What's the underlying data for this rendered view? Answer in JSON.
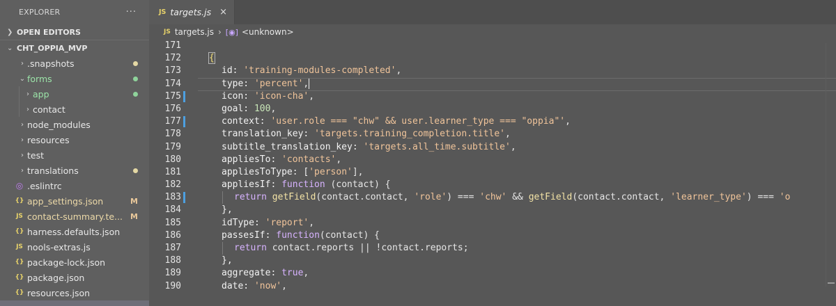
{
  "sidebar": {
    "title": "EXPLORER",
    "more": "···",
    "open_editors": "OPEN EDITORS",
    "project": "CHT_OPPIA_MVP",
    "items": [
      {
        "label": ".snapshots",
        "icon": "folder",
        "status": "dot"
      },
      {
        "label": "forms",
        "icon": "folder-open",
        "status": "dot-green"
      },
      {
        "label": "app",
        "icon": "folder",
        "status": "dot-green"
      },
      {
        "label": "contact",
        "icon": "folder",
        "status": ""
      },
      {
        "label": "node_modules",
        "icon": "folder",
        "status": ""
      },
      {
        "label": "resources",
        "icon": "folder",
        "status": ""
      },
      {
        "label": "test",
        "icon": "folder",
        "status": ""
      },
      {
        "label": "translations",
        "icon": "folder",
        "status": "dot"
      },
      {
        "label": ".eslintrc",
        "icon": "eslint-icon",
        "status": ""
      },
      {
        "label": "app_settings.json",
        "icon": "json-icon",
        "status": "M"
      },
      {
        "label": "contact-summary.te...",
        "icon": "js-icon",
        "status": "M"
      },
      {
        "label": "harness.defaults.json",
        "icon": "json-icon",
        "status": ""
      },
      {
        "label": "nools-extras.js",
        "icon": "js-icon",
        "status": ""
      },
      {
        "label": "package-lock.json",
        "icon": "json-icon",
        "status": ""
      },
      {
        "label": "package.json",
        "icon": "json-icon",
        "status": ""
      },
      {
        "label": "resources.json",
        "icon": "json-icon",
        "status": ""
      }
    ]
  },
  "tab": {
    "label": "targets.js",
    "close": "×"
  },
  "breadcrumb": {
    "file": "targets.js",
    "symbol": "<unknown>"
  },
  "code": {
    "lines": [
      {
        "n": "171"
      },
      {
        "n": "172"
      },
      {
        "n": "173"
      },
      {
        "n": "174"
      },
      {
        "n": "175"
      },
      {
        "n": "176"
      },
      {
        "n": "177"
      },
      {
        "n": "178"
      },
      {
        "n": "179"
      },
      {
        "n": "180"
      },
      {
        "n": "181"
      },
      {
        "n": "182"
      },
      {
        "n": "183"
      },
      {
        "n": "184"
      },
      {
        "n": "185"
      },
      {
        "n": "186"
      },
      {
        "n": "187"
      },
      {
        "n": "188"
      },
      {
        "n": "189"
      },
      {
        "n": "190"
      }
    ],
    "text": {
      "l172": "{",
      "l173a": "id: ",
      "l173b": "'training-modules-completed'",
      "l173c": ",",
      "l174a": "type: ",
      "l174b": "'percent'",
      "l174c": ",",
      "l175a": "icon: ",
      "l175b": "'icon-cha'",
      "l175c": ",",
      "l176a": "goal: ",
      "l176b": "100",
      "l176c": ",",
      "l177a": "context: ",
      "l177b": "'user.role === \"chw\" && user.learner_type === \"oppia\"'",
      "l177c": ",",
      "l178a": "translation_key: ",
      "l178b": "'targets.training_completion.title'",
      "l178c": ",",
      "l179a": "subtitle_translation_key: ",
      "l179b": "'targets.all_time.subtitle'",
      "l179c": ",",
      "l180a": "appliesTo: ",
      "l180b": "'contacts'",
      "l180c": ",",
      "l181a": "appliesToType: [",
      "l181b": "'person'",
      "l181c": "],",
      "l182a": "appliesIf: ",
      "l182b": "function",
      "l182c": " (contact) {",
      "l183a": "return ",
      "l183b": "getField",
      "l183c": "(contact.contact, ",
      "l183d": "'role'",
      "l183e": ") === ",
      "l183f": "'chw'",
      "l183g": " && ",
      "l183h": "getField",
      "l183i": "(contact.contact, ",
      "l183j": "'learner_type'",
      "l183k": ") === ",
      "l183l": "'o",
      "l184": "},",
      "l185a": "idType: ",
      "l185b": "'report'",
      "l185c": ",",
      "l186a": "passesIf: ",
      "l186b": "function",
      "l186c": "(contact) {",
      "l187a": "return ",
      "l187b": "contact.reports || !contact.reports;",
      "l188": "},",
      "l189a": "aggregate: ",
      "l189b": "true",
      "l189c": ",",
      "l190a": "date: ",
      "l190b": "'now'",
      "l190c": ","
    }
  }
}
